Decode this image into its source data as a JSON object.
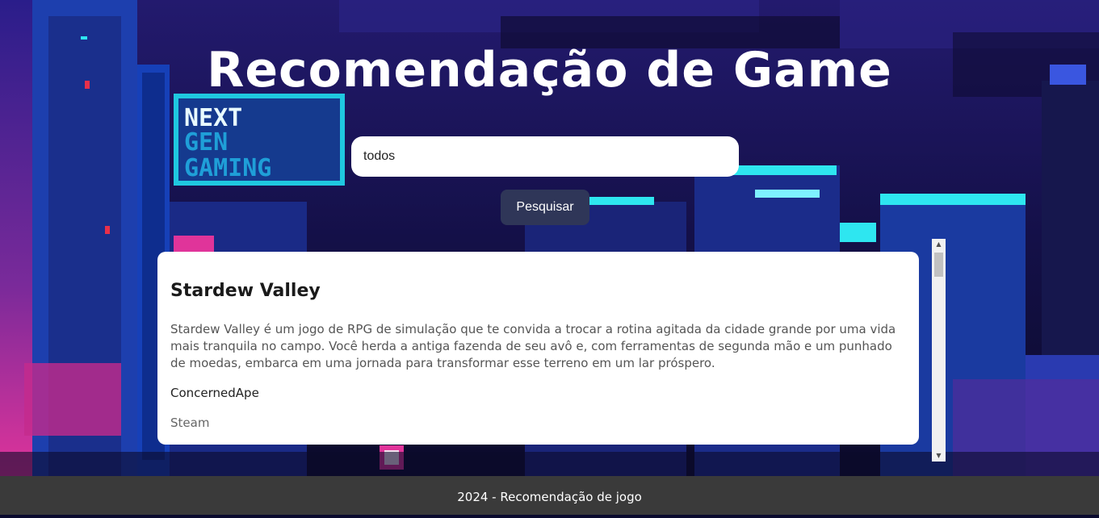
{
  "header": {
    "title": "Recomendação de Game"
  },
  "sign": {
    "line1": "NEXT",
    "line2": "GEN",
    "line3": "GAMING"
  },
  "search": {
    "value": "todos",
    "button_label": "Pesquisar"
  },
  "results": [
    {
      "title": "Stardew Valley",
      "description": "Stardew Valley é um jogo de RPG de simulação que te convida a trocar a rotina agitada da cidade grande por uma vida mais tranquila no campo. Você herda a antiga fazenda de seu avô e, com ferramentas de segunda mão e um punhado de moedas, embarca em uma jornada para transformar esse terreno em um lar próspero.",
      "developer": "ConcernedApe",
      "platform": "Steam"
    }
  ],
  "footer": {
    "text": "2024 - Recomendação de jogo"
  },
  "colors": {
    "button": "#2f3658",
    "footer": "#3a3a3a",
    "sky": "#1a1560",
    "neon_cyan": "#2ee6f0",
    "neon_pink": "#e0349a"
  }
}
